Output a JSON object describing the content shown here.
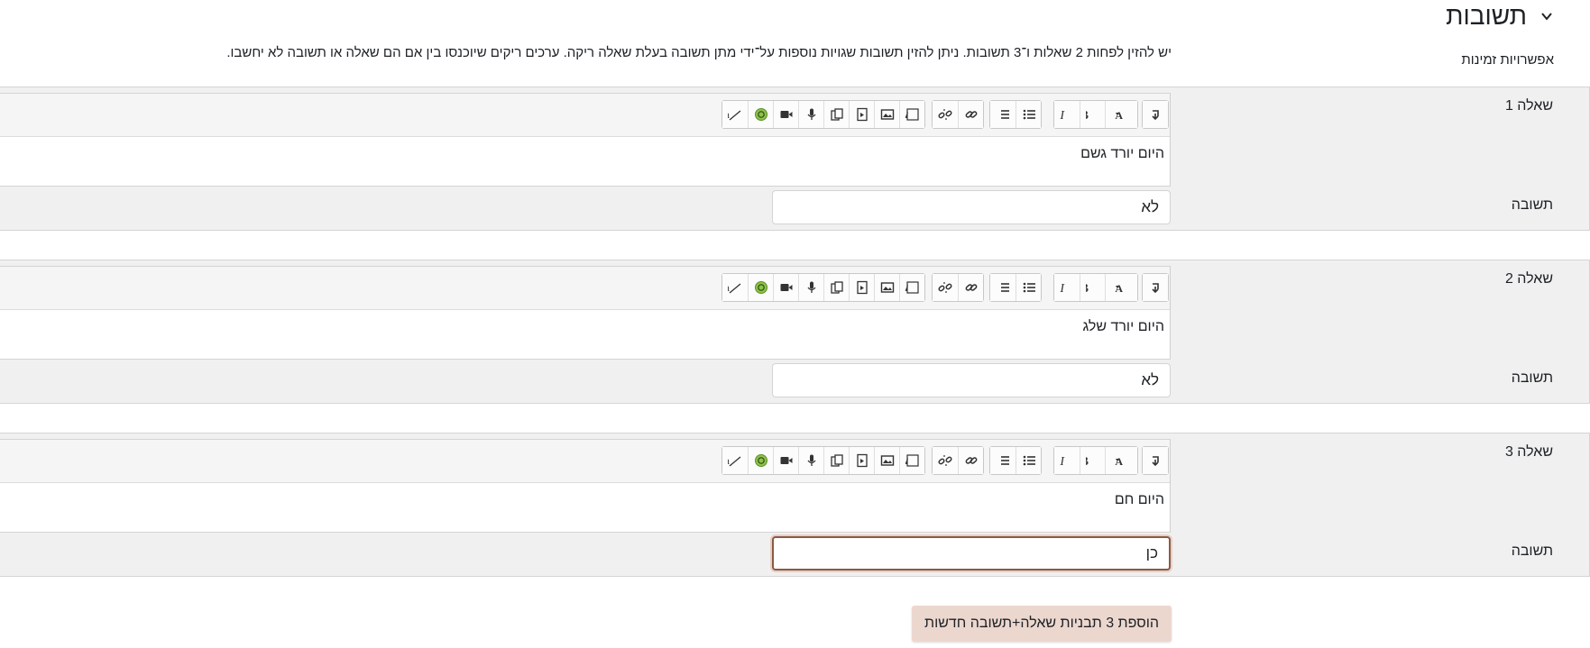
{
  "section": {
    "title": "תשובות"
  },
  "options": {
    "label": "אפשרויות זמינות",
    "note": "יש להזין לפחות 2 שאלות ו־3 תשובות. ניתן להזין תשובות שגויות נוספות על־ידי מתן תשובה בעלת שאלה ריקה. ערכים ריקים שיוכנסו בין אם הם שאלה או תשובה לא יחשבו."
  },
  "toolbar_icons": [
    "expand-toolbar-icon",
    "font-format-icon",
    "bold-icon",
    "italic-icon",
    "unordered-list-icon",
    "ordered-list-icon",
    "link-icon",
    "unlink-icon",
    "word-import-icon",
    "image-icon",
    "media-icon",
    "manage-files-icon",
    "record-audio-icon",
    "record-video-icon",
    "emoji-icon",
    "clear-formatting-icon"
  ],
  "questions": [
    {
      "label": "שאלה 1",
      "text": "היום יורד גשם",
      "answer_label": "תשובה",
      "answer": "לא"
    },
    {
      "label": "שאלה 2",
      "text": "היום יורד שלג",
      "answer_label": "תשובה",
      "answer": "לא"
    },
    {
      "label": "שאלה 3",
      "text": "היום חם",
      "answer_label": "תשובה",
      "answer": "כן"
    }
  ],
  "add_button": {
    "label": "הוספת 3 תבניות שאלה+תשובה חדשות"
  }
}
